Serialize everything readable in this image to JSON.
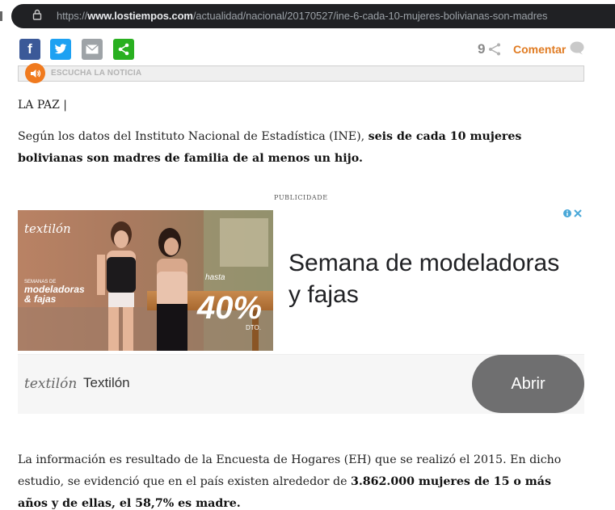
{
  "browser": {
    "url_prefix": "https://",
    "url_domain": "www.lostiempos.com",
    "url_path": "/actualidad/nacional/20170527/ine-6-cada-10-mujeres-bolivianas-son-madres"
  },
  "share": {
    "facebook": "f",
    "count": "9",
    "comment_label": "Comentar",
    "audio_label": "ESCUCHA LA NOTICIA"
  },
  "article": {
    "dateline": "LA PAZ |",
    "p1_text": "Según los datos del Instituto Nacional de Estadística (INE), ",
    "p1_bold": "seis de cada 10 mujeres bolivianas son madres de familia de al menos un hijo.",
    "p2_text_a": "La información es resultado de la Encuesta de Hogares (EH) que se realizó el 2015. En dicho estudio, se evidenció que en el país existen alrededor de ",
    "p2_bold": "3.862.000 mujeres de 15 o más años y de ellas, el 58,7% es madre."
  },
  "ad": {
    "publicidade": "PUBLICIDADE",
    "img_logo": "textilón",
    "img_promo_small": "SEMANAS DE",
    "img_promo_big1": "modeladoras",
    "img_promo_big2": "& fajas",
    "img_hasta": "hasta",
    "img_percent": "40%",
    "img_dto": "DTO.",
    "headline": "Semana de modeladoras y fajas",
    "logo_text": "textilón",
    "brand": "Textilón",
    "cta": "Abrir"
  },
  "colors": {
    "facebook": "#3b5998",
    "twitter": "#1da1f2",
    "email": "#9ea3a7",
    "share": "#29b020",
    "accent": "#e07b22",
    "audio_button": "#f07a1e"
  }
}
